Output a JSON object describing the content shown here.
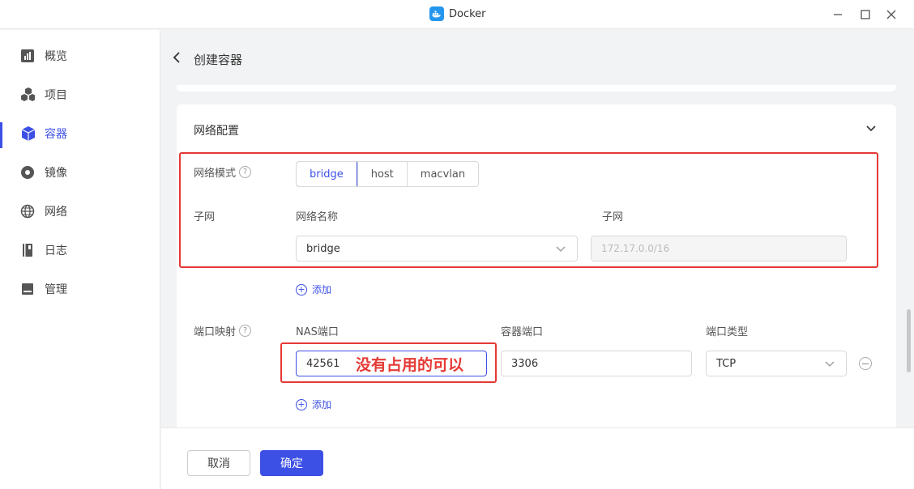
{
  "window": {
    "title": "Docker",
    "controls": [
      "minimize-icon",
      "maximize-icon",
      "close-icon"
    ]
  },
  "sidebar": {
    "items": [
      {
        "label": "概览",
        "icon": "chart-icon",
        "active": false
      },
      {
        "label": "项目",
        "icon": "cubes-icon",
        "active": false
      },
      {
        "label": "容器",
        "icon": "container-icon",
        "active": true
      },
      {
        "label": "镜像",
        "icon": "disc-icon",
        "active": false
      },
      {
        "label": "网络",
        "icon": "globe-icon",
        "active": false
      },
      {
        "label": "日志",
        "icon": "book-icon",
        "active": false
      },
      {
        "label": "管理",
        "icon": "manage-icon",
        "active": false
      }
    ]
  },
  "header": {
    "title": "创建容器"
  },
  "network": {
    "section_title": "网络配置",
    "mode_label": "网络模式",
    "modes": [
      "bridge",
      "host",
      "macvlan"
    ],
    "selected_mode": "bridge",
    "subnet_label": "子网",
    "network_name_label": "网络名称",
    "subnet_col_label": "子网",
    "network_name_value": "bridge",
    "subnet_value": "172.17.0.0/16",
    "add_label": "添加"
  },
  "ports": {
    "label": "端口映射",
    "nas_port_label": "NAS端口",
    "container_port_label": "容器端口",
    "port_type_label": "端口类型",
    "nas_port_value": "42561",
    "container_port_value": "3306",
    "port_type_value": "TCP",
    "annotation": "没有占用的可以",
    "add_label": "添加"
  },
  "footer": {
    "cancel_label": "取消",
    "ok_label": "确定"
  },
  "colors": {
    "accent": "#3d50e6",
    "annotation": "#e53935"
  }
}
